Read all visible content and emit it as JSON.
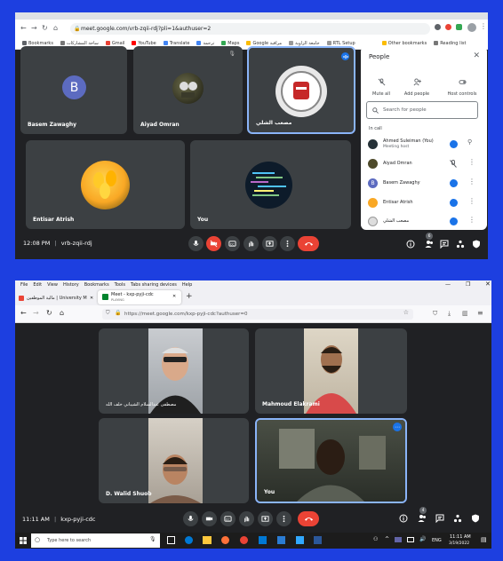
{
  "top": {
    "browser": {
      "url": "meet.google.com/vrb-zqii-rdj?pli=1&authuser=2",
      "bookmarks": [
        "Bookmarks",
        "ساحة المشاركات",
        "Gmail",
        "YouTube",
        "Translate",
        "ترجمة",
        "Maps",
        "Google مراقبة",
        "جامعة الزاوية",
        "RTL Setup"
      ],
      "other_bookmarks": "Other bookmarks",
      "reading_list": "Reading list"
    },
    "tiles": [
      {
        "name": "Basem Zawaghy",
        "initial": "B"
      },
      {
        "name": "Aiyad Omran"
      },
      {
        "name": "مصعب الشلي"
      },
      {
        "name": "Entisar Atrish"
      },
      {
        "name": "You"
      }
    ],
    "bottom_bar": {
      "time": "12:08 PM",
      "separator": "|",
      "code": "vrb-zqii-rdj",
      "participants_badge": "6"
    },
    "people_panel": {
      "title": "People",
      "mute_all": "Mute all",
      "add_people": "Add people",
      "host_controls": "Host controls",
      "search_placeholder": "Search for people",
      "in_call": "In call",
      "people": [
        {
          "name": "Ahmed Suleiman (You)",
          "sub": "Meeting host"
        },
        {
          "name": "Aiyad Omran",
          "sub": ""
        },
        {
          "name": "Basem Zawaghy",
          "sub": "",
          "initial": "B"
        },
        {
          "name": "Entisar Atrish",
          "sub": ""
        },
        {
          "name": "مصعب الشلي",
          "sub": ""
        }
      ]
    }
  },
  "bottom": {
    "menu": [
      "File",
      "Edit",
      "View",
      "History",
      "Bookmarks",
      "Tools",
      "Tabs sharing devices",
      "Help"
    ],
    "tabs": [
      {
        "label": "مالية الموظفين | University Mail -"
      },
      {
        "label": "Meet - kxp-pyji-cdc",
        "sub": "PLAYING"
      }
    ],
    "url": "https://meet.google.com/kxp-pyji-cdc?authuser=0",
    "tiles": [
      {
        "name": "مصطفى عبدالسلام الشيباني خلف الله"
      },
      {
        "name": "Mahmoud Elakrami"
      },
      {
        "name": "D. Walid Shuob"
      },
      {
        "name": "You"
      }
    ],
    "bottom_bar": {
      "time": "11:11 AM",
      "separator": "|",
      "code": "kxp-pyji-cdc",
      "participants_badge": "4"
    },
    "taskbar": {
      "search_placeholder": "Type here to search",
      "lang": "ENG",
      "time": "11:11 AM",
      "date": "3/19/2022"
    }
  },
  "colors": {
    "frame": "#1d3fe0",
    "meet_bg": "#202124",
    "tile": "#3c4043",
    "end_call": "#ea4335",
    "accent": "#1a73e8"
  }
}
